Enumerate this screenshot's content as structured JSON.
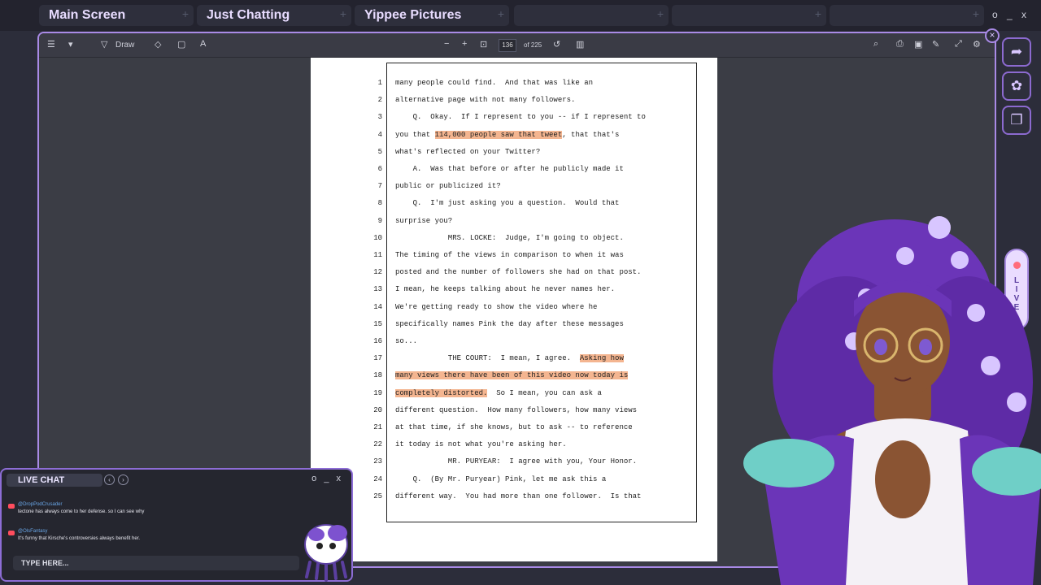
{
  "stream_tabs": [
    {
      "label": "Main Screen"
    },
    {
      "label": "Just Chatting"
    },
    {
      "label": "Yippee Pictures"
    },
    {
      "label": ""
    },
    {
      "label": ""
    },
    {
      "label": ""
    }
  ],
  "window_controls": "o _ x",
  "pdf_toolbar": {
    "draw_label": "Draw",
    "page_number": "136",
    "page_of": "of 225"
  },
  "transcript": {
    "lines": [
      {
        "n": "1",
        "segs": [
          {
            "t": "many people could find.  And that was like an",
            "h": false
          }
        ]
      },
      {
        "n": "2",
        "segs": [
          {
            "t": "alternative page with not many followers.",
            "h": false
          }
        ]
      },
      {
        "n": "3",
        "segs": [
          {
            "t": "    Q.  Okay.  If I represent to you -- if I represent to",
            "h": false
          }
        ]
      },
      {
        "n": "4",
        "segs": [
          {
            "t": "you that ",
            "h": false
          },
          {
            "t": "114,000 people saw that tweet",
            "h": true
          },
          {
            "t": ", that that's",
            "h": false
          }
        ]
      },
      {
        "n": "5",
        "segs": [
          {
            "t": "what's reflected on your Twitter?",
            "h": false
          }
        ]
      },
      {
        "n": "6",
        "segs": [
          {
            "t": "    A.  Was that before or after he publicly made it",
            "h": false
          }
        ]
      },
      {
        "n": "7",
        "segs": [
          {
            "t": "public or publicized it?",
            "h": false
          }
        ]
      },
      {
        "n": "8",
        "segs": [
          {
            "t": "    Q.  I'm just asking you a question.  Would that",
            "h": false
          }
        ]
      },
      {
        "n": "9",
        "segs": [
          {
            "t": "surprise you?",
            "h": false
          }
        ]
      },
      {
        "n": "10",
        "segs": [
          {
            "t": "            MRS. LOCKE:  Judge, I'm going to object.",
            "h": false
          }
        ]
      },
      {
        "n": "11",
        "segs": [
          {
            "t": "The timing of the views in comparison to when it was",
            "h": false
          }
        ]
      },
      {
        "n": "12",
        "segs": [
          {
            "t": "posted and the number of followers she had on that post.",
            "h": false
          }
        ]
      },
      {
        "n": "13",
        "segs": [
          {
            "t": "I mean, he keeps talking about he never names her.",
            "h": false
          }
        ]
      },
      {
        "n": "14",
        "segs": [
          {
            "t": "We're getting ready to show the video where he",
            "h": false
          }
        ]
      },
      {
        "n": "15",
        "segs": [
          {
            "t": "specifically names Pink the day after these messages",
            "h": false
          }
        ]
      },
      {
        "n": "16",
        "segs": [
          {
            "t": "so...",
            "h": false
          }
        ]
      },
      {
        "n": "17",
        "segs": [
          {
            "t": "            THE COURT:  I mean, I agree.  ",
            "h": false
          },
          {
            "t": "Asking how",
            "h": true
          }
        ]
      },
      {
        "n": "18",
        "segs": [
          {
            "t": "many views there have been of this video now today is",
            "h": true
          }
        ]
      },
      {
        "n": "19",
        "segs": [
          {
            "t": "completely distorted.",
            "h": true
          },
          {
            "t": "  So I mean, you can ask a",
            "h": false
          }
        ]
      },
      {
        "n": "20",
        "segs": [
          {
            "t": "different question.  How many followers, how many views",
            "h": false
          }
        ]
      },
      {
        "n": "21",
        "segs": [
          {
            "t": "at that time, if she knows, but to ask -- to reference",
            "h": false
          }
        ]
      },
      {
        "n": "22",
        "segs": [
          {
            "t": "it today is not what you're asking her.",
            "h": false
          }
        ]
      },
      {
        "n": "23",
        "segs": [
          {
            "t": "            MR. PURYEAR:  I agree with you, Your Honor.",
            "h": false
          }
        ]
      },
      {
        "n": "24",
        "segs": [
          {
            "t": "    Q.  (By Mr. Puryear) Pink, let me ask this a",
            "h": false
          }
        ]
      },
      {
        "n": "25",
        "segs": [
          {
            "t": "different way.  You had more than one follower.  Is that",
            "h": false
          }
        ]
      }
    ]
  },
  "live_badge": "LIVE",
  "chat": {
    "title": "LIVE CHAT",
    "controls": "o _ x",
    "messages": [
      {
        "user": "@DropPodCrusader",
        "text": "tectone has always come to her defense. so I can see why"
      },
      {
        "user": "@OlsFantasy",
        "text": "It's funny that Kirsche's controversies always benefit her."
      }
    ],
    "input_placeholder": "TYPE HERE..."
  },
  "colors": {
    "accent": "#a98ae6",
    "highlight": "#f4b590",
    "tab_text": "#e8dcff",
    "badge": "#ff4d5e"
  }
}
